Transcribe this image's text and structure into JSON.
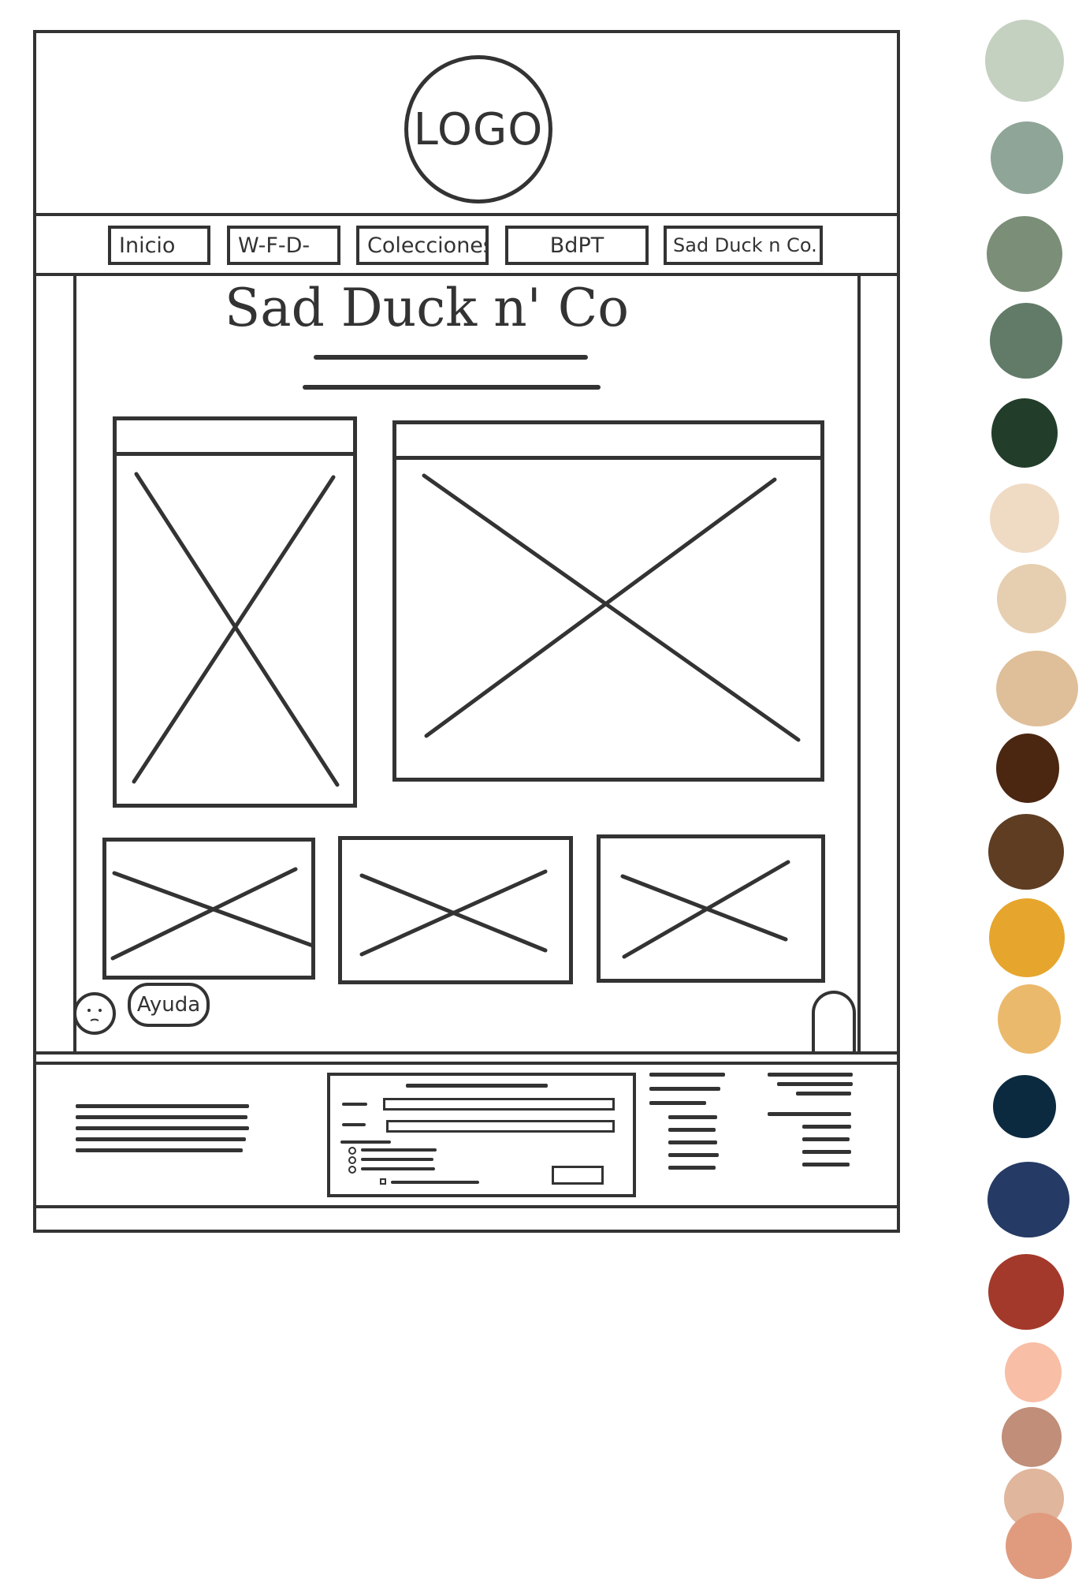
{
  "header": {
    "logo_text": "LOGO"
  },
  "nav": {
    "items": [
      {
        "label": "Inicio"
      },
      {
        "label": "W-F-D-"
      },
      {
        "label": "Colecciones"
      },
      {
        "label": "BdPT"
      },
      {
        "label": "Sad Duck n Co."
      }
    ]
  },
  "main": {
    "title": "Sad Duck n' Co"
  },
  "help": {
    "label": "Ayuda"
  },
  "palette": {
    "colors": [
      "#c4d0c0",
      "#8fa597",
      "#7b8e77",
      "#627b68",
      "#233d2b",
      "#efdac4",
      "#e6cfb0",
      "#dfbf99",
      "#4b2611",
      "#5e3d23",
      "#e6a52c",
      "#ebb96c",
      "#0c2a3f",
      "#253a64",
      "#a3392a",
      "#f8bea6",
      "#c08e79",
      "#e0b69c",
      "#e09b7f"
    ]
  }
}
